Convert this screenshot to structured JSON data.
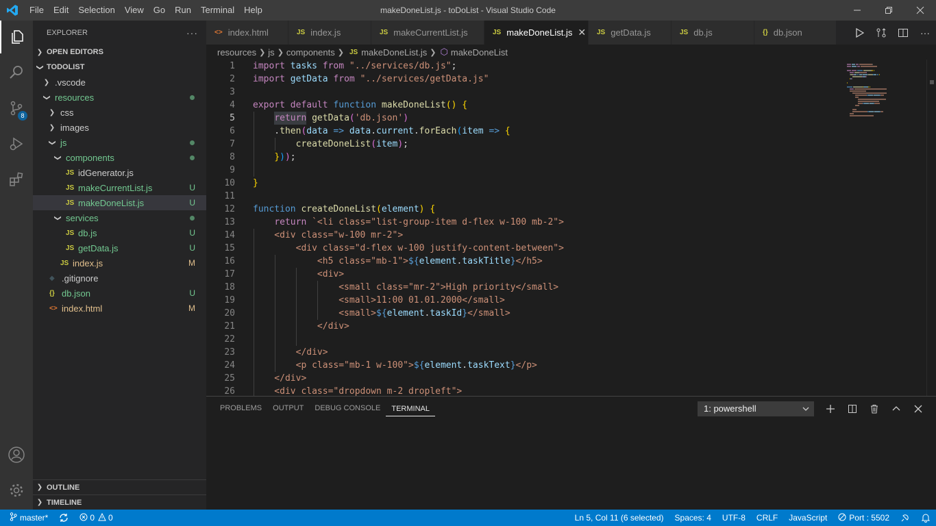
{
  "window": {
    "title": "makeDoneList.js - toDoList - Visual Studio Code",
    "menu": [
      "File",
      "Edit",
      "Selection",
      "View",
      "Go",
      "Run",
      "Terminal",
      "Help"
    ]
  },
  "activity_bar": {
    "items": [
      "explorer-icon",
      "search-icon",
      "source-control-icon",
      "run-debug-icon",
      "extensions-icon"
    ],
    "scm_badge": "8",
    "bottom": [
      "account-icon",
      "manage-gear-icon"
    ]
  },
  "sidebar": {
    "header": "EXPLORER",
    "more": "···",
    "open_editors": "OPEN EDITORS",
    "project": "TODOLIST",
    "tree": [
      {
        "label": ".vscode",
        "type": "folder",
        "open": false,
        "status": "",
        "color": "#cccccc"
      },
      {
        "label": "resources",
        "type": "folder",
        "open": true,
        "status": "dot",
        "color": "#73c991"
      },
      {
        "label": "css",
        "type": "folder",
        "open": false,
        "status": "",
        "color": "#cccccc"
      },
      {
        "label": "images",
        "type": "folder",
        "open": false,
        "status": "",
        "color": "#cccccc"
      },
      {
        "label": "js",
        "type": "folder",
        "open": true,
        "status": "dot",
        "color": "#73c991"
      },
      {
        "label": "components",
        "type": "folder",
        "open": true,
        "status": "dot",
        "color": "#73c991"
      },
      {
        "label": "idGenerator.js",
        "type": "js",
        "status": "",
        "color": "#cccccc"
      },
      {
        "label": "makeCurrentList.js",
        "type": "js",
        "status": "U",
        "color": "#73c991"
      },
      {
        "label": "makeDoneList.js",
        "type": "js",
        "status": "U",
        "color": "#73c991",
        "selected": true
      },
      {
        "label": "services",
        "type": "folder",
        "open": true,
        "status": "dot",
        "color": "#73c991"
      },
      {
        "label": "db.js",
        "type": "js",
        "status": "U",
        "color": "#73c991"
      },
      {
        "label": "getData.js",
        "type": "js",
        "status": "U",
        "color": "#73c991"
      },
      {
        "label": "index.js",
        "type": "js",
        "status": "M",
        "color": "#e2c08d"
      },
      {
        "label": ".gitignore",
        "type": "git",
        "status": "",
        "color": "#cccccc"
      },
      {
        "label": "db.json",
        "type": "json",
        "status": "U",
        "color": "#73c991"
      },
      {
        "label": "index.html",
        "type": "html",
        "status": "M",
        "color": "#e2c08d"
      }
    ],
    "outline": "OUTLINE",
    "timeline": "TIMELINE"
  },
  "tabs": [
    {
      "label": "index.html",
      "icon": "<>",
      "icon_color": "#e37933",
      "active": false
    },
    {
      "label": "index.js",
      "icon": "JS",
      "icon_color": "#cbcb41",
      "active": false
    },
    {
      "label": "makeCurrentList.js",
      "icon": "JS",
      "icon_color": "#cbcb41",
      "active": false
    },
    {
      "label": "makeDoneList.js",
      "icon": "JS",
      "icon_color": "#cbcb41",
      "active": true
    },
    {
      "label": "getData.js",
      "icon": "JS",
      "icon_color": "#cbcb41",
      "active": false
    },
    {
      "label": "db.js",
      "icon": "JS",
      "icon_color": "#cbcb41",
      "active": false
    },
    {
      "label": "db.json",
      "icon": "{}",
      "icon_color": "#cbcb41",
      "active": false
    }
  ],
  "breadcrumb": [
    "resources",
    "js",
    "components",
    "makeDoneList.js",
    "makeDoneList"
  ],
  "code": {
    "current_line": 5,
    "lines": [
      [
        [
          "kw",
          "import"
        ],
        [
          "pl",
          " "
        ],
        [
          "var",
          "tasks"
        ],
        [
          "pl",
          " "
        ],
        [
          "kw",
          "from"
        ],
        [
          "pl",
          " "
        ],
        [
          "str",
          "\"../services/db.js\""
        ],
        [
          "pl",
          ";"
        ]
      ],
      [
        [
          "kw",
          "import"
        ],
        [
          "pl",
          " "
        ],
        [
          "var",
          "getData"
        ],
        [
          "pl",
          " "
        ],
        [
          "kw",
          "from"
        ],
        [
          "pl",
          " "
        ],
        [
          "str",
          "\"../services/getData.js\""
        ]
      ],
      [],
      [
        [
          "kw",
          "export"
        ],
        [
          "pl",
          " "
        ],
        [
          "kw",
          "default"
        ],
        [
          "pl",
          " "
        ],
        [
          "kb",
          "function"
        ],
        [
          "pl",
          " "
        ],
        [
          "fn",
          "makeDoneList"
        ],
        [
          "br1",
          "()"
        ],
        [
          "pl",
          " "
        ],
        [
          "br1",
          "{"
        ]
      ],
      [
        [
          "pl",
          "    "
        ],
        [
          "kw",
          "return"
        ],
        [
          "pl",
          " "
        ],
        [
          "fn",
          "getData"
        ],
        [
          "br2",
          "("
        ],
        [
          "str",
          "'db.json'"
        ],
        [
          "br2",
          ")"
        ]
      ],
      [
        [
          "pl",
          "    ."
        ],
        [
          "fn",
          "then"
        ],
        [
          "br2",
          "("
        ],
        [
          "var",
          "data"
        ],
        [
          "pl",
          " "
        ],
        [
          "kb",
          "=>"
        ],
        [
          "pl",
          " "
        ],
        [
          "var",
          "data"
        ],
        [
          "pl",
          "."
        ],
        [
          "var",
          "current"
        ],
        [
          "pl",
          "."
        ],
        [
          "fn",
          "forEach"
        ],
        [
          "br3",
          "("
        ],
        [
          "var",
          "item"
        ],
        [
          "pl",
          " "
        ],
        [
          "kb",
          "=>"
        ],
        [
          "pl",
          " "
        ],
        [
          "br1",
          "{"
        ]
      ],
      [
        [
          "pl",
          "        "
        ],
        [
          "fn",
          "createDoneList"
        ],
        [
          "br2",
          "("
        ],
        [
          "var",
          "item"
        ],
        [
          "br2",
          ")"
        ],
        [
          "pl",
          ";"
        ]
      ],
      [
        [
          "pl",
          "    "
        ],
        [
          "br1",
          "}"
        ],
        [
          "br3",
          ")"
        ],
        [
          "br2",
          ")"
        ],
        [
          "pl",
          ";"
        ]
      ],
      [],
      [
        [
          "br1",
          "}"
        ]
      ],
      [],
      [
        [
          "kb",
          "function"
        ],
        [
          "pl",
          " "
        ],
        [
          "fn",
          "createDoneList"
        ],
        [
          "br1",
          "("
        ],
        [
          "var",
          "element"
        ],
        [
          "br1",
          ")"
        ],
        [
          "pl",
          " "
        ],
        [
          "br1",
          "{"
        ]
      ],
      [
        [
          "pl",
          "    "
        ],
        [
          "kw",
          "return"
        ],
        [
          "pl",
          " "
        ],
        [
          "str",
          "`<li class=\"list-group-item d-flex w-100 mb-2\">"
        ]
      ],
      [
        [
          "str",
          "    <div class=\"w-100 mr-2\">"
        ]
      ],
      [
        [
          "str",
          "        <div class=\"d-flex w-100 justify-content-between\">"
        ]
      ],
      [
        [
          "str",
          "            <h5 class=\"mb-1\">"
        ],
        [
          "kb",
          "${"
        ],
        [
          "var",
          "element"
        ],
        [
          "pl",
          "."
        ],
        [
          "var",
          "taskTitle"
        ],
        [
          "kb",
          "}"
        ],
        [
          "str",
          "</h5>"
        ]
      ],
      [
        [
          "str",
          "            <div>"
        ]
      ],
      [
        [
          "str",
          "                <small class=\"mr-2\">High priority</small>"
        ]
      ],
      [
        [
          "str",
          "                <small>11:00 01.01.2000</small>"
        ]
      ],
      [
        [
          "str",
          "                <small>"
        ],
        [
          "kb",
          "${"
        ],
        [
          "var",
          "element"
        ],
        [
          "pl",
          "."
        ],
        [
          "var",
          "taskId"
        ],
        [
          "kb",
          "}"
        ],
        [
          "str",
          "</small>"
        ]
      ],
      [
        [
          "str",
          "            </div>"
        ]
      ],
      [],
      [
        [
          "str",
          "        </div>"
        ]
      ],
      [
        [
          "str",
          "        <p class=\"mb-1 w-100\">"
        ],
        [
          "kb",
          "${"
        ],
        [
          "var",
          "element"
        ],
        [
          "pl",
          "."
        ],
        [
          "var",
          "taskText"
        ],
        [
          "kb",
          "}"
        ],
        [
          "str",
          "</p>"
        ]
      ],
      [
        [
          "str",
          "    </div>"
        ]
      ],
      [
        [
          "str",
          "    <div class=\"dropdown m-2 dropleft\">"
        ]
      ]
    ]
  },
  "panel": {
    "tabs": [
      "PROBLEMS",
      "OUTPUT",
      "DEBUG CONSOLE",
      "TERMINAL"
    ],
    "active_tab": "TERMINAL",
    "terminal_select": "1: powershell"
  },
  "statusbar": {
    "branch": "master*",
    "errors": "0",
    "warnings": "0",
    "position": "Ln 5, Col 11 (6 selected)",
    "spaces": "Spaces: 4",
    "encoding": "UTF-8",
    "eol": "CRLF",
    "language": "JavaScript",
    "port": "Port : 5502"
  },
  "colors": {
    "accent": "#007acc",
    "activity_bar": "#333333",
    "sidebar": "#252526",
    "editor": "#1e1e1e"
  }
}
